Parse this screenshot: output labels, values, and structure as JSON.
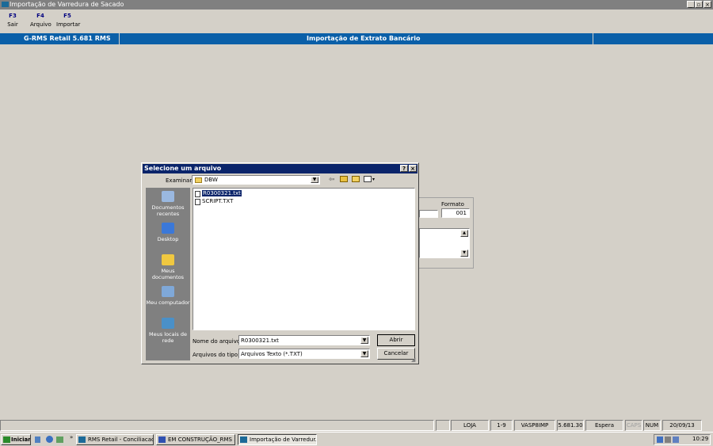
{
  "window": {
    "title": "Importação de Varredura de Sacado"
  },
  "toolbar": [
    {
      "key": "F3",
      "label": "Sair"
    },
    {
      "key": "F4",
      "label": "Arquivo"
    },
    {
      "key": "F5",
      "label": "Importar"
    }
  ],
  "header": {
    "app": "G-RMS Retail 5.681 RMS",
    "module": "Importação de Extrato Bancário"
  },
  "background_form": {
    "formato_label": "Formato",
    "formato_value": "001"
  },
  "dialog": {
    "title": "Selecione um arquivo",
    "look_in_label": "Examinar:",
    "look_in_value": "DBW",
    "places": [
      "Documentos recentes",
      "Desktop",
      "Meus documentos",
      "Meu computador",
      "Meus locais de rede"
    ],
    "files": [
      "R0300321.txt",
      "SCRIPT.TXT"
    ],
    "filename_label": "Nome do arquivo:",
    "filename_value": "R0300321.txt",
    "filetype_label": "Arquivos do tipo:",
    "filetype_value": "Arquivos Texto (*.TXT)",
    "open_button": "Abrir",
    "cancel_button": "Cancelar"
  },
  "statusbar": [
    "LOJA",
    "1-9",
    "VASP8IMP",
    "5.681.30",
    "Espera",
    "CAPS",
    "NUM",
    "20/09/13"
  ],
  "taskbar": {
    "start": "Iniciar",
    "items": [
      "RMS Retail - Conciliacao ...",
      "EM CONSTRUÇÃO_RMS ...",
      "Importação de Varredur..."
    ],
    "clock": "10:29"
  }
}
